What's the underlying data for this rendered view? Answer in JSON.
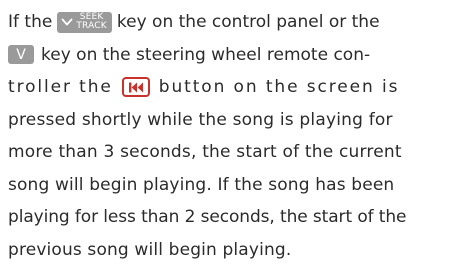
{
  "paragraph": {
    "line1": {
      "before": "If the",
      "after": "key on the control panel or the"
    },
    "line2": {
      "after": "key on the steering wheel remote con-"
    },
    "line3": {
      "before": "troller the",
      "after": "button on the screen is"
    },
    "line4": "pressed shortly while the song is playing for",
    "line5": "more than 3 seconds, the start of the current",
    "line6": "song will begin playing. If the song has been",
    "line7": "playing for less than 2 seconds, the start of the",
    "line8": "previous song will begin playing."
  },
  "keys": {
    "seek_top": "SEEK",
    "seek_bottom": "TRACK",
    "v_key": "V",
    "prev_icon": "skip-previous-icon"
  },
  "colors": {
    "text": "#2b2b2b",
    "key_gray": "#9a9a9a",
    "prev_border": "#c9322c",
    "prev_icon": "#c9322c"
  }
}
